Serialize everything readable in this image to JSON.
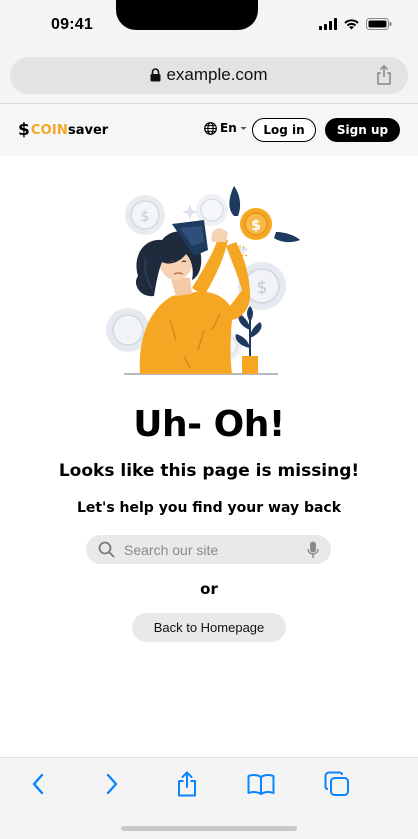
{
  "status_bar": {
    "time": "09:41"
  },
  "browser": {
    "url": "example.com"
  },
  "nav": {
    "logo_coin": "COIN",
    "logo_saver": "saver",
    "language": "En",
    "login_label": "Log in",
    "signup_label": "Sign up"
  },
  "main": {
    "headline": "Uh- Oh!",
    "subheadline": "Looks like this page is missing!",
    "subtext": "Let's help you find your way back",
    "search_placeholder": "Search our site",
    "or_label": "or",
    "home_button_label": "Back to Homepage"
  },
  "colors": {
    "brand_accent": "#f5a623",
    "illustration_navy": "#1f3a5f",
    "illustration_orange": "#f5a623",
    "ios_blue": "#0a84ff"
  },
  "toolbar": {
    "icons": [
      "back-icon",
      "forward-icon",
      "share-icon",
      "bookmarks-icon",
      "tabs-icon"
    ]
  }
}
